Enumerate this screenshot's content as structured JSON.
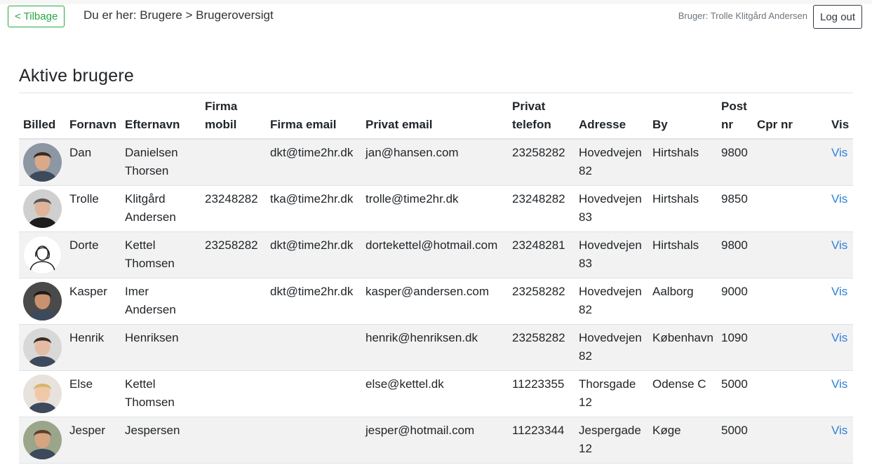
{
  "header": {
    "back_label": "< Tilbage",
    "breadcrumb": "Du er her: Brugere > Brugeroversigt",
    "user_label": "Bruger: Trolle Klitgård Andersen",
    "logout_label": "Log out"
  },
  "page": {
    "title": "Aktive brugere"
  },
  "table": {
    "columns": {
      "billed": "Billed",
      "fornavn": "Fornavn",
      "efternavn": "Efternavn",
      "firma_mobil": "Firma mobil",
      "firma_email": "Firma email",
      "privat_email": "Privat email",
      "privat_telefon": "Privat telefon",
      "adresse": "Adresse",
      "by": "By",
      "post_nr": "Post nr",
      "cpr_nr": "Cpr nr",
      "vis": "Vis"
    },
    "rows": [
      {
        "fornavn": "Dan",
        "efternavn": "Danielsen Thorsen",
        "firma_mobil": "",
        "firma_email": "dkt@time2hr.dk",
        "privat_email": "jan@hansen.com",
        "privat_telefon": "23258282",
        "adresse": "Hovedvejen 82",
        "by": "Hirtshals",
        "post_nr": "9800",
        "cpr_nr": "",
        "vis": "Vis",
        "avatar": "person-photo"
      },
      {
        "fornavn": "Trolle",
        "efternavn": "Klitgård Andersen",
        "firma_mobil": "23248282",
        "firma_email": "tka@time2hr.dk",
        "privat_email": "trolle@time2hr.dk",
        "privat_telefon": "23248282",
        "adresse": "Hovedvejen 83",
        "by": "Hirtshals",
        "post_nr": "9850",
        "cpr_nr": "",
        "vis": "Vis",
        "avatar": "person-photo"
      },
      {
        "fornavn": "Dorte",
        "efternavn": "Kettel Thomsen",
        "firma_mobil": "23258282",
        "firma_email": "dkt@time2hr.dk",
        "privat_email": "dortekettel@hotmail.com",
        "privat_telefon": "23248281",
        "adresse": "Hovedvejen 83",
        "by": "Hirtshals",
        "post_nr": "9800",
        "cpr_nr": "",
        "vis": "Vis",
        "avatar": "female-placeholder-icon"
      },
      {
        "fornavn": "Kasper",
        "efternavn": "Imer Andersen",
        "firma_mobil": "",
        "firma_email": "dkt@time2hr.dk",
        "privat_email": "kasper@andersen.com",
        "privat_telefon": "23258282",
        "adresse": "Hovedvejen 82",
        "by": "Aalborg",
        "post_nr": "9000",
        "cpr_nr": "",
        "vis": "Vis",
        "avatar": "person-photo"
      },
      {
        "fornavn": "Henrik",
        "efternavn": "Henriksen",
        "firma_mobil": "",
        "firma_email": "",
        "privat_email": "henrik@henriksen.dk",
        "privat_telefon": "23258282",
        "adresse": "Hovedvejen 82",
        "by": "København",
        "post_nr": "1090",
        "cpr_nr": "",
        "vis": "Vis",
        "avatar": "person-photo"
      },
      {
        "fornavn": "Else",
        "efternavn": "Kettel Thomsen",
        "firma_mobil": "",
        "firma_email": "",
        "privat_email": "else@kettel.dk",
        "privat_telefon": "11223355",
        "adresse": "Thorsgade 12",
        "by": "Odense C",
        "post_nr": "5000",
        "cpr_nr": "",
        "vis": "Vis",
        "avatar": "person-photo"
      },
      {
        "fornavn": "Jesper",
        "efternavn": "Jespersen",
        "firma_mobil": "",
        "firma_email": "",
        "privat_email": "jesper@hotmail.com",
        "privat_telefon": "11223344",
        "adresse": "Jespergade 12",
        "by": "Køge",
        "post_nr": "5000",
        "cpr_nr": "",
        "vis": "Vis",
        "avatar": "person-photo"
      }
    ]
  },
  "colors": {
    "accent_green": "#28a745",
    "link_blue": "#2f80d9",
    "stripe": "#f2f2f2"
  }
}
